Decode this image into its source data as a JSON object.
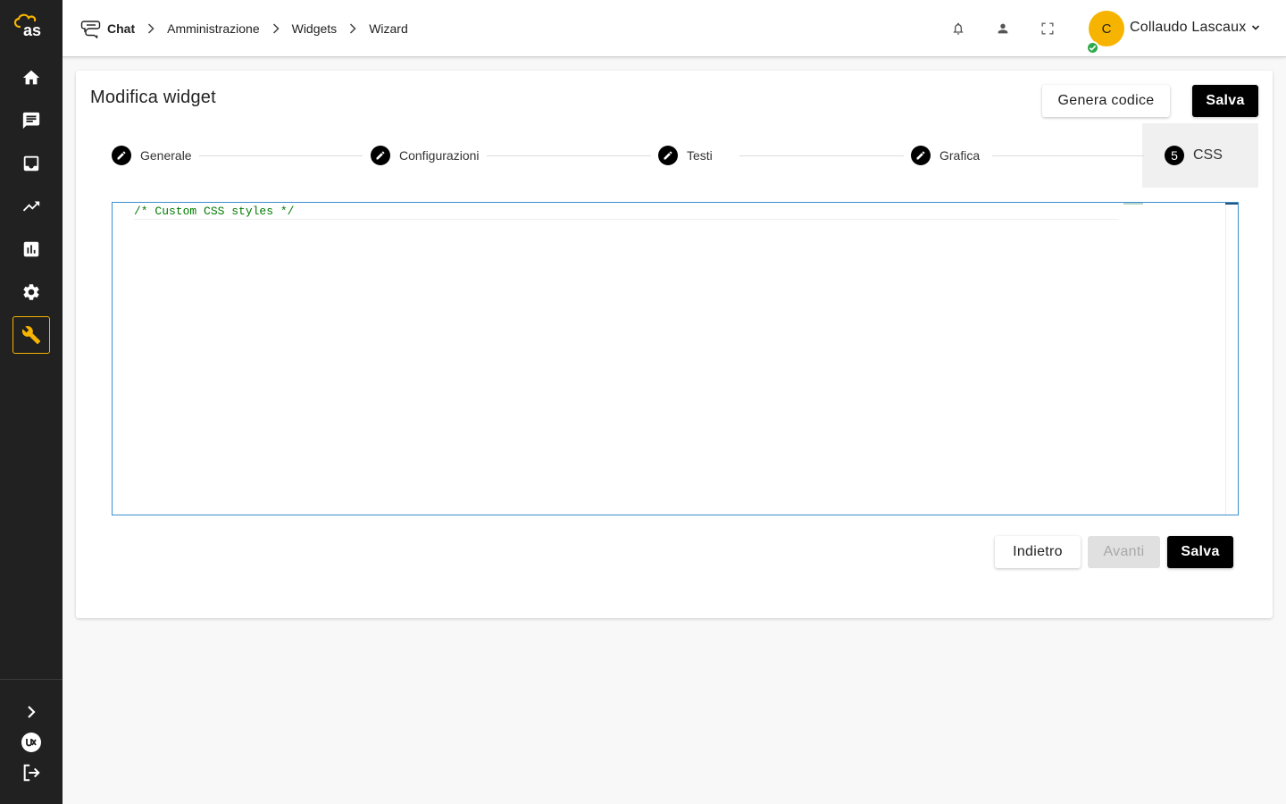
{
  "brand": {
    "logo_text": "as",
    "accent": "#f6b400"
  },
  "sidebar": {
    "items": [
      {
        "name": "home",
        "icon": "home-icon",
        "active": false
      },
      {
        "name": "chat",
        "icon": "chat-icon",
        "active": false
      },
      {
        "name": "inbox",
        "icon": "inbox-icon",
        "active": false
      },
      {
        "name": "trends",
        "icon": "trending-up-icon",
        "active": false
      },
      {
        "name": "reports",
        "icon": "bar-chart-icon",
        "active": false
      },
      {
        "name": "settings",
        "icon": "gear-icon",
        "active": false
      },
      {
        "name": "tools",
        "icon": "wrench-icon",
        "active": true
      }
    ],
    "bottom": [
      {
        "name": "expand",
        "icon": "chevron-right-icon"
      },
      {
        "name": "brand",
        "icon": "ux-logo-icon"
      },
      {
        "name": "logout",
        "icon": "logout-icon"
      }
    ]
  },
  "header": {
    "breadcrumb": [
      "Chat",
      "Amministrazione",
      "Widgets",
      "Wizard"
    ],
    "icons": [
      "bell-icon",
      "person-icon",
      "fullscreen-icon"
    ],
    "user": {
      "initial": "C",
      "name": "Collaudo Lascaux",
      "status_color": "#2eaa4a"
    }
  },
  "card": {
    "title": "Modifica widget",
    "genera_label": "Genera codice",
    "salva_top_label": "Salva",
    "steps": [
      {
        "label": "Generale",
        "state": "done"
      },
      {
        "label": "Configurazioni",
        "state": "done"
      },
      {
        "label": "Testi",
        "state": "done"
      },
      {
        "label": "Grafica",
        "state": "done"
      },
      {
        "label": "CSS",
        "number": "5",
        "state": "active"
      }
    ],
    "editor": {
      "code": "/* Custom CSS styles */"
    },
    "footer": {
      "back_label": "Indietro",
      "next_label": "Avanti",
      "save_label": "Salva"
    }
  }
}
